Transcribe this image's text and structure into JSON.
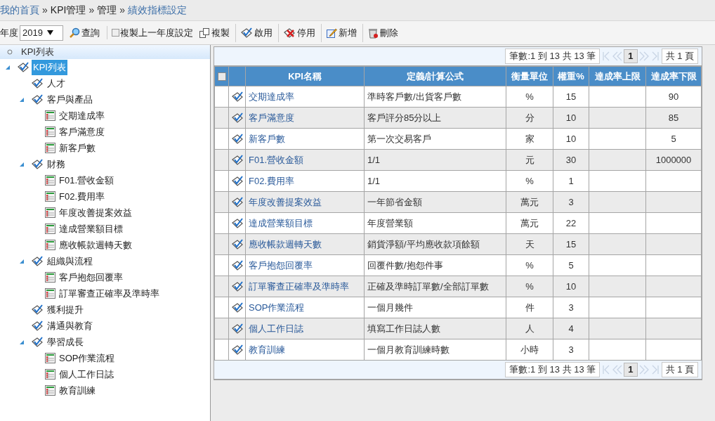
{
  "breadcrumb": {
    "separator": "»",
    "items": [
      {
        "label": "我的首頁",
        "link": true
      },
      {
        "label": "KPI管理",
        "link": false
      },
      {
        "label": "管理",
        "link": false
      },
      {
        "label": "績效指標設定",
        "link": true
      }
    ]
  },
  "toolbar": {
    "year_label": "年度",
    "year_value": "2019",
    "items": [
      {
        "kind": "search",
        "label": "查詢"
      },
      {
        "kind": "checkbox",
        "label": "複製上一年度設定",
        "checked": false
      },
      {
        "kind": "copy",
        "label": "複製"
      },
      {
        "kind": "enable",
        "label": "啟用"
      },
      {
        "kind": "disable",
        "label": "停用"
      },
      {
        "kind": "add",
        "label": "新增"
      },
      {
        "kind": "delete",
        "label": "刪除"
      }
    ]
  },
  "tree": {
    "header": "KPI列表",
    "nodes": [
      {
        "label": "KPI列表",
        "kind": "folder",
        "selected": true,
        "expanded": true,
        "children": [
          {
            "label": "人才",
            "kind": "folder",
            "selected": false
          },
          {
            "label": "客戶與產品",
            "kind": "folder",
            "selected": false,
            "expanded": true,
            "children": [
              {
                "label": "交期達成率",
                "kind": "item",
                "selected": false
              },
              {
                "label": "客戶滿意度",
                "kind": "item",
                "selected": false
              },
              {
                "label": "新客戶數",
                "kind": "item",
                "selected": false
              }
            ]
          },
          {
            "label": "財務",
            "kind": "folder",
            "selected": false,
            "expanded": true,
            "children": [
              {
                "label": "F01.營收金額",
                "kind": "item",
                "selected": false
              },
              {
                "label": "F02.費用率",
                "kind": "item",
                "selected": false
              },
              {
                "label": "年度改善提案效益",
                "kind": "item",
                "selected": false
              },
              {
                "label": "達成營業額目標",
                "kind": "item",
                "selected": false
              },
              {
                "label": "應收帳款週轉天數",
                "kind": "item",
                "selected": false
              }
            ]
          },
          {
            "label": "組織與流程",
            "kind": "folder",
            "selected": false,
            "expanded": true,
            "children": [
              {
                "label": "客戶抱怨回覆率",
                "kind": "item",
                "selected": false
              },
              {
                "label": "訂單審查正確率及準時率",
                "kind": "item",
                "selected": false
              }
            ]
          },
          {
            "label": "獲利提升",
            "kind": "folder",
            "selected": false
          },
          {
            "label": "溝通與教育",
            "kind": "folder",
            "selected": false
          },
          {
            "label": "學習成長",
            "kind": "folder",
            "selected": false,
            "expanded": true,
            "children": [
              {
                "label": "SOP作業流程",
                "kind": "item",
                "selected": false
              },
              {
                "label": "個人工作日誌",
                "kind": "item",
                "selected": false
              },
              {
                "label": "教育訓練",
                "kind": "item",
                "selected": false
              }
            ]
          }
        ]
      }
    ]
  },
  "grid": {
    "pager_top": {
      "records": "筆數:1 到 13 共 13 筆",
      "page": "1",
      "pages": "共 1 頁"
    },
    "select_all_checked": false,
    "columns": [
      "KPI名稱",
      "定義/計算公式",
      "衡量單位",
      "權重%",
      "達成率上限",
      "達成率下限"
    ],
    "rows": [
      {
        "name": "交期達成率",
        "formula": "準時客戶數/出貨客戶數",
        "unit": "%",
        "weight": "15",
        "upper": "",
        "lower": "90"
      },
      {
        "name": "客戶滿意度",
        "formula": "客戶評分85分以上",
        "unit": "分",
        "weight": "10",
        "upper": "",
        "lower": "85"
      },
      {
        "name": "新客戶數",
        "formula": "第一次交易客戶",
        "unit": "家",
        "weight": "10",
        "upper": "",
        "lower": "5"
      },
      {
        "name": "F01.營收金額",
        "formula": "1/1",
        "unit": "元",
        "weight": "30",
        "upper": "",
        "lower": "1000000"
      },
      {
        "name": "F02.費用率",
        "formula": "1/1",
        "unit": "%",
        "weight": "1",
        "upper": "",
        "lower": ""
      },
      {
        "name": "年度改善提案效益",
        "formula": "一年節省金額",
        "unit": "萬元",
        "weight": "3",
        "upper": "",
        "lower": ""
      },
      {
        "name": "達成營業額目標",
        "formula": "年度營業額",
        "unit": "萬元",
        "weight": "22",
        "upper": "",
        "lower": ""
      },
      {
        "name": "應收帳款週轉天數",
        "formula": "銷貨淨額/平均應收款項餘額",
        "unit": "天",
        "weight": "15",
        "upper": "",
        "lower": ""
      },
      {
        "name": "客戶抱怨回覆率",
        "formula": "回覆件數/抱怨件事",
        "unit": "%",
        "weight": "5",
        "upper": "",
        "lower": ""
      },
      {
        "name": "訂單審查正確率及準時率",
        "formula": "正確及準時訂單數/全部訂單數",
        "unit": "%",
        "weight": "10",
        "upper": "",
        "lower": ""
      },
      {
        "name": "SOP作業流程",
        "formula": "一個月幾件",
        "unit": "件",
        "weight": "3",
        "upper": "",
        "lower": ""
      },
      {
        "name": "個人工作日誌",
        "formula": "填寫工作日誌人數",
        "unit": "人",
        "weight": "4",
        "upper": "",
        "lower": ""
      },
      {
        "name": "教育訓練",
        "formula": "一個月教育訓練時數",
        "unit": "小時",
        "weight": "3",
        "upper": "",
        "lower": ""
      }
    ],
    "pager_bottom": {
      "records": "筆數:1 到 13 共 13 筆",
      "page": "1",
      "pages": "共 1 頁"
    }
  }
}
